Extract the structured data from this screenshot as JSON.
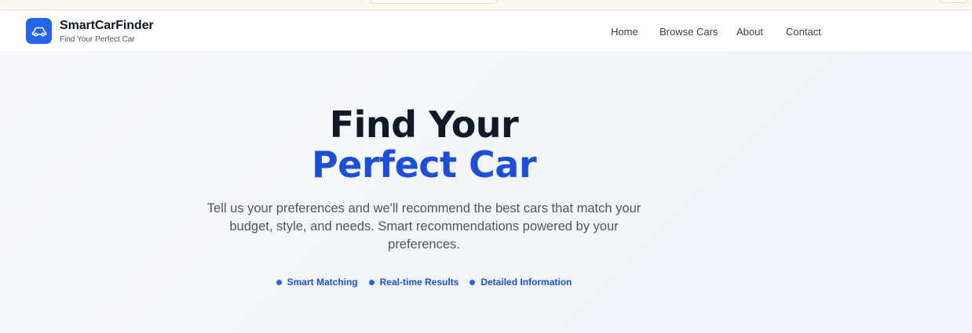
{
  "brand": {
    "name": "SmartCarFinder",
    "tagline": "Find Your Perfect Car",
    "logo_icon": "car-icon",
    "accent_color": "#2563eb"
  },
  "nav": {
    "items": [
      {
        "label": "Home"
      },
      {
        "label": "Browse Cars"
      },
      {
        "label": "About"
      },
      {
        "label": "Contact"
      }
    ]
  },
  "hero": {
    "title_line1": "Find Your",
    "title_line2": "Perfect Car",
    "title_line2_color": "#1d4ed8",
    "description": "Tell us your preferences and we'll recommend the best cars that match your budget, style, and needs. Smart recommendations powered by your preferences.",
    "features": [
      {
        "label": "Smart Matching"
      },
      {
        "label": "Real-time Results"
      },
      {
        "label": "Detailed Information"
      }
    ]
  }
}
